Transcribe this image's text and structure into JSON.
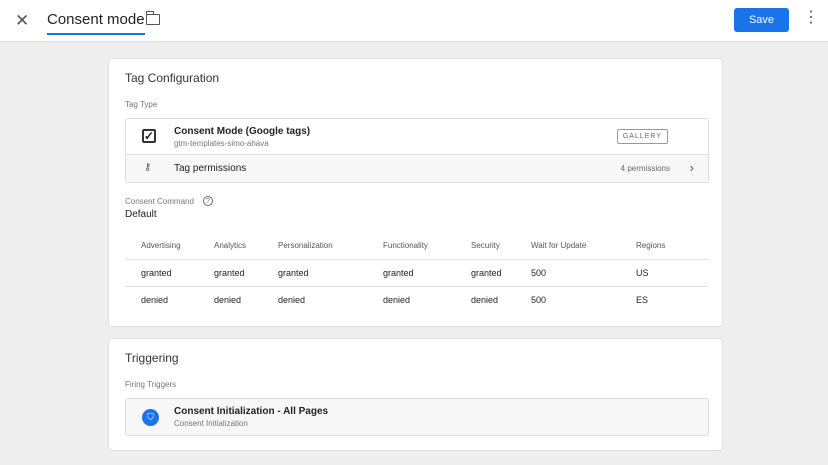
{
  "header": {
    "title": "Consent mode",
    "save": "Save"
  },
  "config": {
    "heading": "Tag Configuration",
    "tag_type_label": "Tag Type",
    "tag_name": "Consent Mode (Google tags)",
    "tag_source": "gtm-templates-simo-ahava",
    "gallery": "GALLERY",
    "permissions_label": "Tag permissions",
    "permissions_count": "4 permissions",
    "command_label": "Consent Command",
    "command_value": "Default",
    "table": {
      "headers": [
        "Advertising",
        "Analytics",
        "Personalization",
        "Functionality",
        "Security",
        "Wait for Update",
        "Regions"
      ],
      "rows": [
        [
          "granted",
          "granted",
          "granted",
          "granted",
          "granted",
          "500",
          "US"
        ],
        [
          "denied",
          "denied",
          "denied",
          "denied",
          "denied",
          "500",
          "ES"
        ]
      ]
    }
  },
  "triggering": {
    "heading": "Triggering",
    "label": "Firing Triggers",
    "trigger_name": "Consent Initialization - All Pages",
    "trigger_type": "Consent Initialization"
  }
}
